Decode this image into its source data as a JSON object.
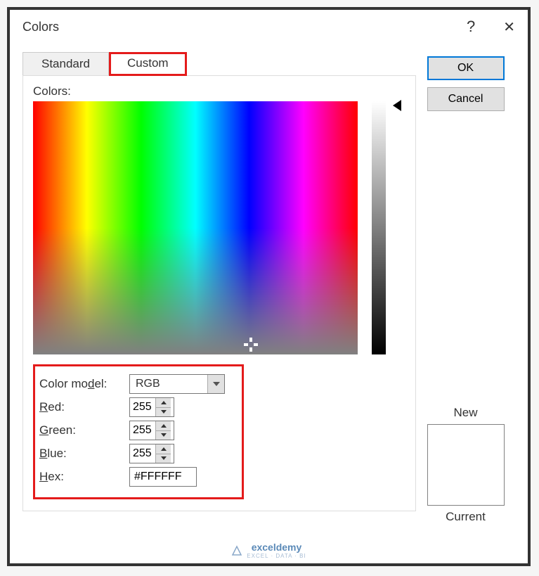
{
  "dialog": {
    "title": "Colors",
    "help_symbol": "?",
    "close_symbol": "✕"
  },
  "tabs": {
    "standard": "Standard",
    "custom": "Custom"
  },
  "picker": {
    "colors_label": "Colors:"
  },
  "fields": {
    "color_model_label": "Color model:",
    "color_model_value": "RGB",
    "red_label": "Red:",
    "red_value": "255",
    "green_label": "Green:",
    "green_value": "255",
    "blue_label": "Blue:",
    "blue_value": "255",
    "hex_label": "Hex:",
    "hex_value": "#FFFFFF"
  },
  "buttons": {
    "ok": "OK",
    "cancel": "Cancel"
  },
  "preview": {
    "new_label": "New",
    "current_label": "Current",
    "new_color": "#FFFFFF",
    "current_color": "#FFFFFF"
  },
  "watermark": {
    "brand": "exceldemy",
    "sub": "EXCEL · DATA · BI"
  }
}
